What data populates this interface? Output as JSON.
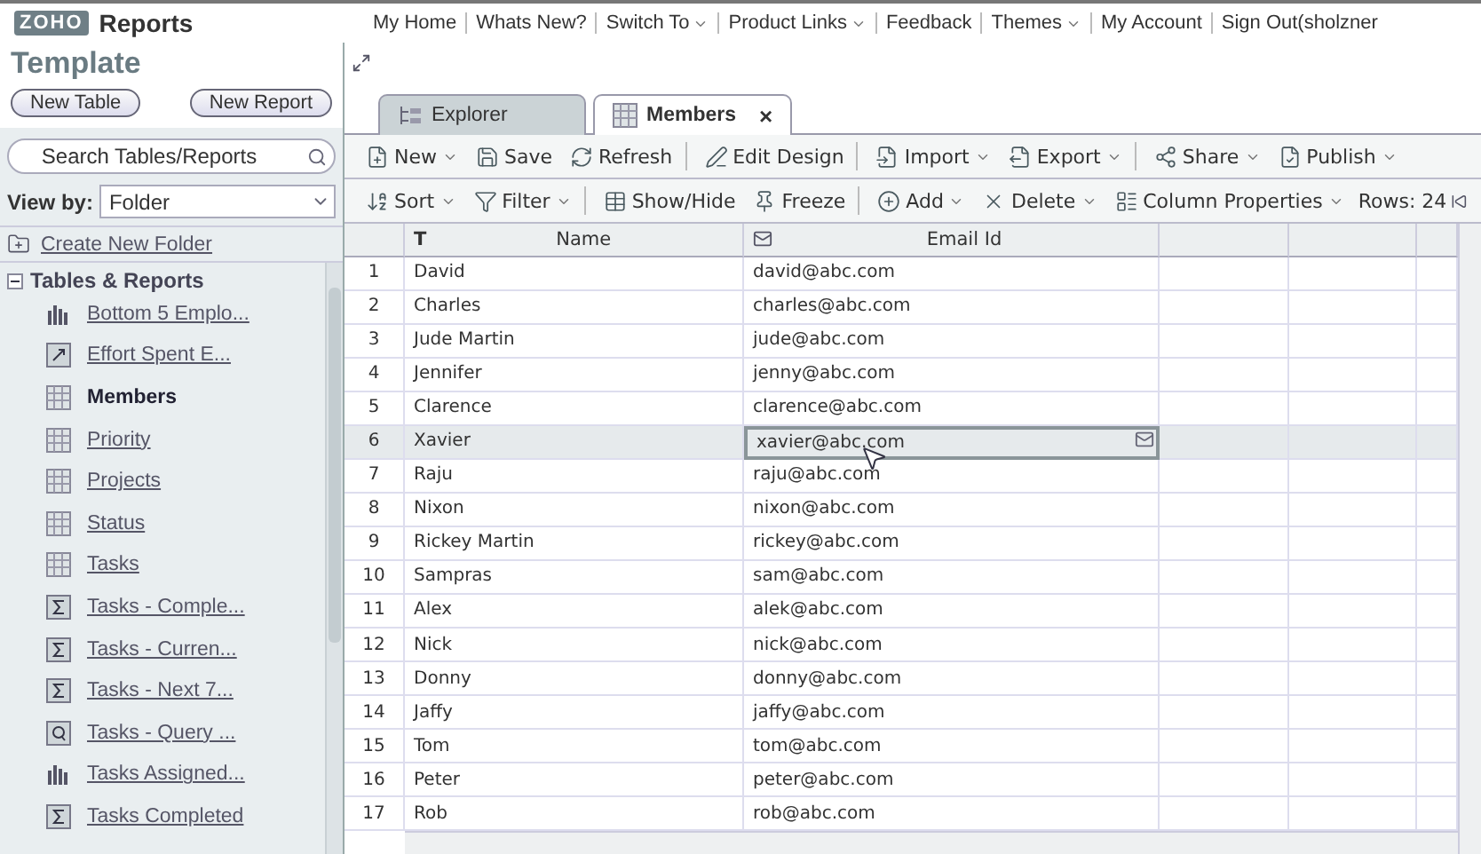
{
  "app": {
    "logo": "ZOHO",
    "name": "Reports"
  },
  "nav_links": [
    {
      "label": "My Home",
      "dropdown": false
    },
    {
      "label": "Whats New?",
      "dropdown": false
    },
    {
      "label": "Switch To",
      "dropdown": true
    },
    {
      "label": "Product Links",
      "dropdown": true
    },
    {
      "label": "Feedback",
      "dropdown": false
    },
    {
      "label": "Themes",
      "dropdown": true
    },
    {
      "label": "My Account",
      "dropdown": false
    },
    {
      "label": "Sign Out(sholzner",
      "dropdown": false
    }
  ],
  "sidebar": {
    "title": "Template",
    "buttons": [
      "New Table",
      "New Report"
    ],
    "search": {
      "placeholder": "Search Tables/Reports"
    },
    "view_by": {
      "label": "View by:",
      "value": "Folder"
    },
    "create_folder": "Create New Folder",
    "tree": {
      "label": "Tables & Reports",
      "expanded": true,
      "children": [
        {
          "label": "Bottom 5 Emplo...",
          "kind": "chart",
          "selected": false
        },
        {
          "label": "Effort Spent E...",
          "kind": "pivot",
          "selected": false
        },
        {
          "label": "Members",
          "kind": "table",
          "selected": true
        },
        {
          "label": "Priority",
          "kind": "table",
          "selected": false
        },
        {
          "label": "Projects",
          "kind": "table",
          "selected": false
        },
        {
          "label": "Status",
          "kind": "table",
          "selected": false
        },
        {
          "label": "Tasks",
          "kind": "table",
          "selected": false
        },
        {
          "label": "Tasks - Comple...",
          "kind": "summary",
          "selected": false
        },
        {
          "label": "Tasks - Curren...",
          "kind": "summary",
          "selected": false
        },
        {
          "label": "Tasks - Next 7...",
          "kind": "summary",
          "selected": false
        },
        {
          "label": "Tasks - Query ...",
          "kind": "query",
          "selected": false
        },
        {
          "label": "Tasks Assigned...",
          "kind": "chart",
          "selected": false
        },
        {
          "label": "Tasks Completed",
          "kind": "summary",
          "selected": false
        }
      ]
    }
  },
  "tabs": [
    {
      "label": "Explorer",
      "kind": "explorer",
      "selected": false
    },
    {
      "label": "Members",
      "kind": "table",
      "selected": true,
      "close": "×"
    }
  ],
  "toolbar": [
    {
      "label": "New",
      "kind": "new",
      "dropdown": true,
      "divider": false
    },
    {
      "label": "Save",
      "kind": "save",
      "dropdown": false,
      "divider": false
    },
    {
      "label": "Refresh",
      "kind": "refresh",
      "dropdown": false,
      "divider": true
    },
    {
      "label": "Edit Design",
      "kind": "design",
      "dropdown": false,
      "divider": true
    },
    {
      "label": "Import",
      "kind": "import",
      "dropdown": true,
      "divider": false
    },
    {
      "label": "Export",
      "kind": "export",
      "dropdown": true,
      "divider": true
    },
    {
      "label": "Share",
      "kind": "share",
      "dropdown": true,
      "divider": false
    },
    {
      "label": "Publish",
      "kind": "publish",
      "dropdown": true,
      "divider": false
    }
  ],
  "grid_toolbar": {
    "items": [
      {
        "label": "Sort",
        "kind": "sort",
        "dropdown": true,
        "divider": false
      },
      {
        "label": "Filter",
        "kind": "filter",
        "dropdown": true,
        "divider": true
      },
      {
        "label": "Show/Hide",
        "kind": "columns",
        "dropdown": false,
        "divider": false
      },
      {
        "label": "Freeze",
        "kind": "pin",
        "dropdown": false,
        "divider": true
      },
      {
        "label": "Add",
        "kind": "add",
        "dropdown": true,
        "divider": false
      },
      {
        "label": "Delete",
        "kind": "delete",
        "dropdown": true,
        "divider": false
      },
      {
        "label": "Column Properties",
        "kind": "properties",
        "dropdown": true,
        "divider": false
      }
    ],
    "rows": "Rows: 24"
  },
  "table": {
    "columns": [
      {
        "kind": "text",
        "mark": "T",
        "label": "Name"
      },
      {
        "kind": "email",
        "label": "Email Id"
      }
    ],
    "rows": [
      {
        "num": "1",
        "name": "David",
        "email": "david@abc.com",
        "selected": false
      },
      {
        "num": "2",
        "name": "Charles",
        "email": "charles@abc.com",
        "selected": false
      },
      {
        "num": "3",
        "name": "Jude Martin",
        "email": "jude@abc.com",
        "selected": false
      },
      {
        "num": "4",
        "name": "Jennifer",
        "email": "jenny@abc.com",
        "selected": false
      },
      {
        "num": "5",
        "name": "Clarence",
        "email": "clarence@abc.com",
        "selected": false
      },
      {
        "num": "6",
        "name": "Xavier",
        "email": "xavier@abc.com",
        "selected": true
      },
      {
        "num": "7",
        "name": "Raju",
        "email": "raju@abc.com",
        "selected": false
      },
      {
        "num": "8",
        "name": "Nixon",
        "email": "nixon@abc.com",
        "selected": false
      },
      {
        "num": "9",
        "name": "Rickey Martin",
        "email": "rickey@abc.com",
        "selected": false
      },
      {
        "num": "10",
        "name": "Sampras",
        "email": "sam@abc.com",
        "selected": false
      },
      {
        "num": "11",
        "name": "Alex",
        "email": "alek@abc.com",
        "selected": false
      },
      {
        "num": "12",
        "name": "Nick",
        "email": "nick@abc.com",
        "selected": false
      },
      {
        "num": "13",
        "name": "Donny",
        "email": "donny@abc.com",
        "selected": false
      },
      {
        "num": "14",
        "name": "Jaffy",
        "email": "jaffy@abc.com",
        "selected": false
      },
      {
        "num": "15",
        "name": "Tom",
        "email": "tom@abc.com",
        "selected": false
      },
      {
        "num": "16",
        "name": "Peter",
        "email": "peter@abc.com",
        "selected": false
      },
      {
        "num": "17",
        "name": "Rob",
        "email": "rob@abc.com",
        "selected": false
      }
    ]
  }
}
